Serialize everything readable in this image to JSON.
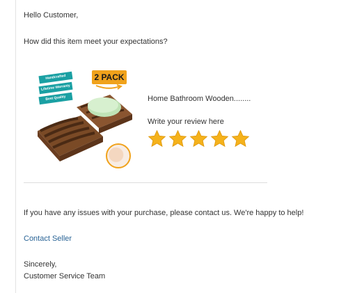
{
  "greeting": "Hello Customer,",
  "question": "How did this item meet your expectations?",
  "product": {
    "name": "Home Bathroom Wooden........",
    "badge": "2 PACK",
    "ribbons": [
      "Handcrafted",
      "Lifetime Warranty",
      "Best Quality"
    ]
  },
  "review": {
    "prompt": "Write your review here",
    "star_count": 5,
    "star_color": "#f5b21b"
  },
  "support_text": "If you have any issues with your purchase, please contact us. We're happy to help!",
  "contact_link": "Contact Seller",
  "signoff": {
    "closing": "Sincerely,",
    "team": "Customer Service Team"
  }
}
